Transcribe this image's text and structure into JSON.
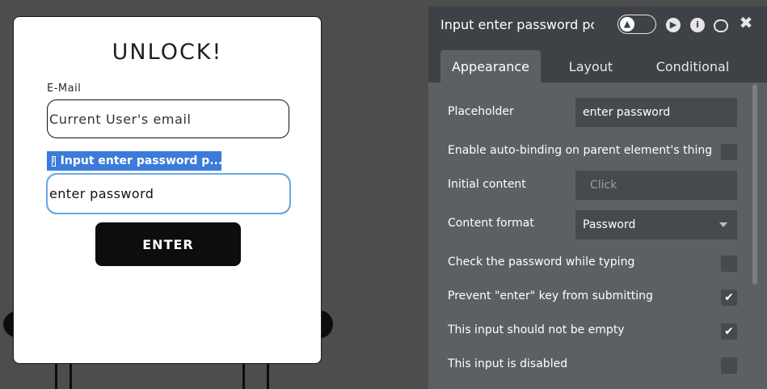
{
  "card": {
    "title": "UNLOCK!",
    "email_label": "E-Mail",
    "email_value": "Current User's email",
    "selection_tag": "Input enter password p...",
    "password_placeholder": "enter password",
    "enter_label": "ENTER"
  },
  "panel": {
    "title": "Input enter password pc",
    "tabs": [
      {
        "label": "Appearance",
        "active": true
      },
      {
        "label": "Layout",
        "active": false
      },
      {
        "label": "Conditional",
        "active": false
      }
    ],
    "placeholder": {
      "label": "Placeholder",
      "value": "enter password"
    },
    "auto_binding": {
      "label": "Enable auto-binding on parent element's thing",
      "checked": false
    },
    "initial_content": {
      "label": "Initial content",
      "value": "Click"
    },
    "content_format": {
      "label": "Content format",
      "value": "Password"
    },
    "check_password": {
      "label": "Check the password while typing",
      "checked": false
    },
    "prevent_enter": {
      "label": "Prevent \"enter\" key from submitting",
      "checked": true
    },
    "not_empty": {
      "label": "This input should not be empty",
      "checked": true
    },
    "disabled": {
      "label": "This input is disabled",
      "checked": false
    }
  },
  "icons": {
    "play": "play-icon",
    "info": "info-icon",
    "chat": "chat-icon",
    "close": "close-icon",
    "toggle": "flask-toggle-icon",
    "checkmark": "✔"
  }
}
